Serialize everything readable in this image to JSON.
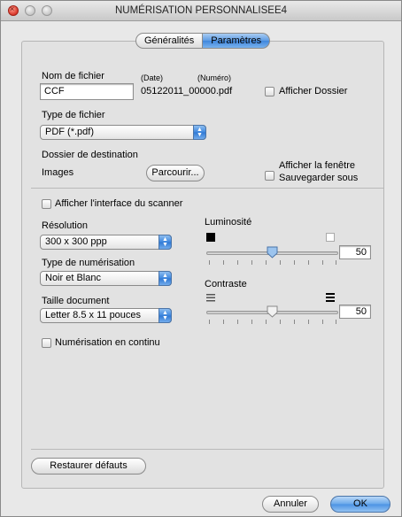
{
  "window": {
    "title": "NUMÉRISATION PERSONNALISEE4"
  },
  "tabs": [
    {
      "label": "Généralités",
      "active": false
    },
    {
      "label": "Paramètres",
      "active": true
    }
  ],
  "file": {
    "name_label": "Nom de fichier",
    "date_hint": "(Date)",
    "number_hint": "(Numéro)",
    "name_value": "CCF",
    "suffix": "05122011_00000.pdf",
    "show_folder_label": "Afficher Dossier",
    "show_folder_checked": false,
    "type_label": "Type de fichier",
    "type_value": "PDF (*.pdf)",
    "dest_label": "Dossier de destination",
    "dest_value": "Images",
    "browse_label": "Parcourir...",
    "save_window_label_1": "Afficher la fenêtre",
    "save_window_label_2": "Sauvegarder sous",
    "save_window_checked": false
  },
  "scanner": {
    "show_ui_label": "Afficher l'interface du scanner",
    "show_ui_checked": false,
    "resolution_label": "Résolution",
    "resolution_value": "300 x 300 ppp",
    "scan_type_label": "Type de numérisation",
    "scan_type_value": "Noir et Blanc",
    "doc_size_label": "Taille document",
    "doc_size_value": "Letter 8.5 x 11 pouces",
    "continuous_label": "Numérisation en continu",
    "continuous_checked": false,
    "brightness_label": "Luminosité",
    "brightness_value": "50",
    "brightness_level": 0.5,
    "contrast_label": "Contraste",
    "contrast_value": "50",
    "contrast_level": 0.5
  },
  "buttons": {
    "restore_label": "Restaurer défauts",
    "cancel_label": "Annuler",
    "ok_label": "OK"
  },
  "icons": {
    "brightness_dark": "black-square-icon",
    "brightness_light": "white-square-icon",
    "contrast_low": "low-contrast-icon",
    "contrast_high": "high-contrast-icon"
  },
  "colors": {
    "accent": "#3f86dd",
    "window_bg": "#e8e8e8"
  }
}
